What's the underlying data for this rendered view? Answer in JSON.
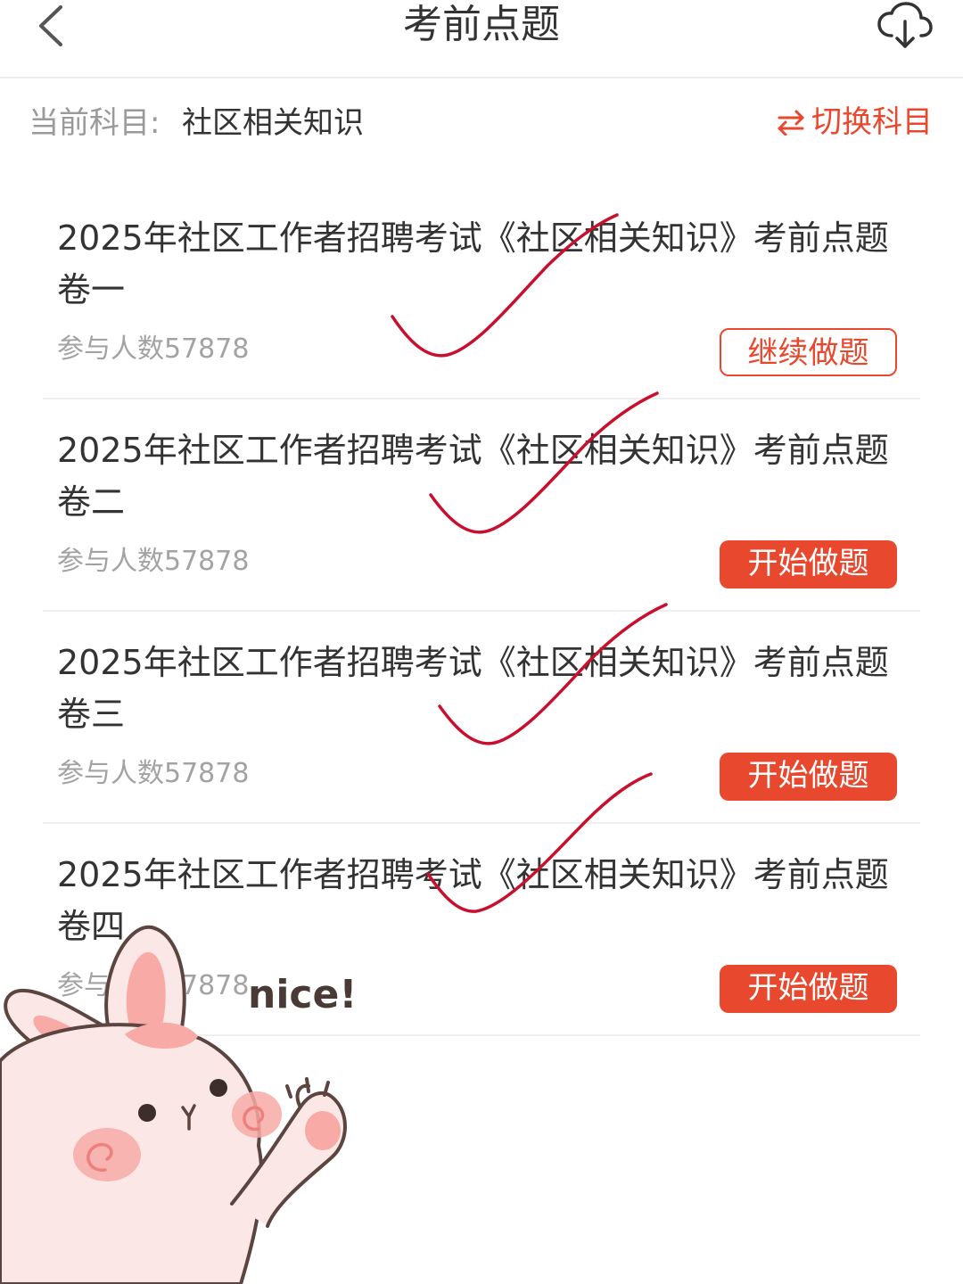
{
  "header": {
    "title": "考前点题",
    "back_icon": "chevron-left-icon",
    "download_icon": "cloud-download-icon"
  },
  "subject": {
    "label": "当前科目:",
    "value": "社区相关知识",
    "switch_label": "切换科目",
    "switch_icon": "swap-arrows-icon"
  },
  "papers": [
    {
      "title": "2025年社区工作者招聘考试《社区相关知识》考前点题卷一",
      "participants": "参与人数57878",
      "button": "继续做题",
      "button_style": "outline"
    },
    {
      "title": "2025年社区工作者招聘考试《社区相关知识》考前点题卷二",
      "participants": "参与人数57878",
      "button": "开始做题",
      "button_style": "filled"
    },
    {
      "title": "2025年社区工作者招聘考试《社区相关知识》考前点题卷三",
      "participants": "参与人数57878",
      "button": "开始做题",
      "button_style": "filled"
    },
    {
      "title": "2025年社区工作者招聘考试《社区相关知识》考前点题卷四",
      "participants": "参与人数57878",
      "button": "开始做题",
      "button_style": "filled"
    }
  ],
  "sticker": {
    "text": "nice!"
  },
  "colors": {
    "accent": "#e8482e",
    "check_mark": "#c8102e",
    "muted_text": "#a3a3a3",
    "divider": "#efefef"
  }
}
